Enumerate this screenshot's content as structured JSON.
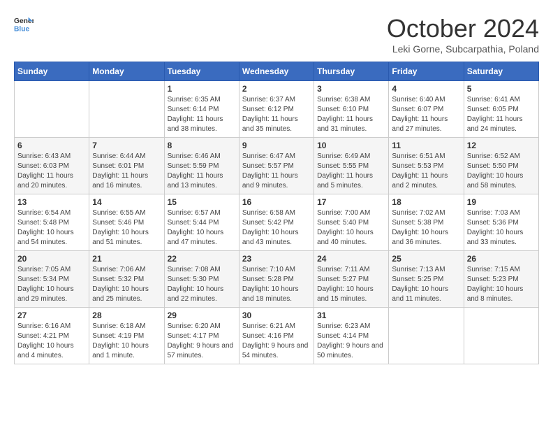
{
  "header": {
    "logo_line1": "General",
    "logo_line2": "Blue",
    "month_title": "October 2024",
    "subtitle": "Leki Gorne, Subcarpathia, Poland"
  },
  "days_of_week": [
    "Sunday",
    "Monday",
    "Tuesday",
    "Wednesday",
    "Thursday",
    "Friday",
    "Saturday"
  ],
  "weeks": [
    [
      {
        "day": "",
        "detail": ""
      },
      {
        "day": "",
        "detail": ""
      },
      {
        "day": "1",
        "detail": "Sunrise: 6:35 AM\nSunset: 6:14 PM\nDaylight: 11 hours and 38 minutes."
      },
      {
        "day": "2",
        "detail": "Sunrise: 6:37 AM\nSunset: 6:12 PM\nDaylight: 11 hours and 35 minutes."
      },
      {
        "day": "3",
        "detail": "Sunrise: 6:38 AM\nSunset: 6:10 PM\nDaylight: 11 hours and 31 minutes."
      },
      {
        "day": "4",
        "detail": "Sunrise: 6:40 AM\nSunset: 6:07 PM\nDaylight: 11 hours and 27 minutes."
      },
      {
        "day": "5",
        "detail": "Sunrise: 6:41 AM\nSunset: 6:05 PM\nDaylight: 11 hours and 24 minutes."
      }
    ],
    [
      {
        "day": "6",
        "detail": "Sunrise: 6:43 AM\nSunset: 6:03 PM\nDaylight: 11 hours and 20 minutes."
      },
      {
        "day": "7",
        "detail": "Sunrise: 6:44 AM\nSunset: 6:01 PM\nDaylight: 11 hours and 16 minutes."
      },
      {
        "day": "8",
        "detail": "Sunrise: 6:46 AM\nSunset: 5:59 PM\nDaylight: 11 hours and 13 minutes."
      },
      {
        "day": "9",
        "detail": "Sunrise: 6:47 AM\nSunset: 5:57 PM\nDaylight: 11 hours and 9 minutes."
      },
      {
        "day": "10",
        "detail": "Sunrise: 6:49 AM\nSunset: 5:55 PM\nDaylight: 11 hours and 5 minutes."
      },
      {
        "day": "11",
        "detail": "Sunrise: 6:51 AM\nSunset: 5:53 PM\nDaylight: 11 hours and 2 minutes."
      },
      {
        "day": "12",
        "detail": "Sunrise: 6:52 AM\nSunset: 5:50 PM\nDaylight: 10 hours and 58 minutes."
      }
    ],
    [
      {
        "day": "13",
        "detail": "Sunrise: 6:54 AM\nSunset: 5:48 PM\nDaylight: 10 hours and 54 minutes."
      },
      {
        "day": "14",
        "detail": "Sunrise: 6:55 AM\nSunset: 5:46 PM\nDaylight: 10 hours and 51 minutes."
      },
      {
        "day": "15",
        "detail": "Sunrise: 6:57 AM\nSunset: 5:44 PM\nDaylight: 10 hours and 47 minutes."
      },
      {
        "day": "16",
        "detail": "Sunrise: 6:58 AM\nSunset: 5:42 PM\nDaylight: 10 hours and 43 minutes."
      },
      {
        "day": "17",
        "detail": "Sunrise: 7:00 AM\nSunset: 5:40 PM\nDaylight: 10 hours and 40 minutes."
      },
      {
        "day": "18",
        "detail": "Sunrise: 7:02 AM\nSunset: 5:38 PM\nDaylight: 10 hours and 36 minutes."
      },
      {
        "day": "19",
        "detail": "Sunrise: 7:03 AM\nSunset: 5:36 PM\nDaylight: 10 hours and 33 minutes."
      }
    ],
    [
      {
        "day": "20",
        "detail": "Sunrise: 7:05 AM\nSunset: 5:34 PM\nDaylight: 10 hours and 29 minutes."
      },
      {
        "day": "21",
        "detail": "Sunrise: 7:06 AM\nSunset: 5:32 PM\nDaylight: 10 hours and 25 minutes."
      },
      {
        "day": "22",
        "detail": "Sunrise: 7:08 AM\nSunset: 5:30 PM\nDaylight: 10 hours and 22 minutes."
      },
      {
        "day": "23",
        "detail": "Sunrise: 7:10 AM\nSunset: 5:28 PM\nDaylight: 10 hours and 18 minutes."
      },
      {
        "day": "24",
        "detail": "Sunrise: 7:11 AM\nSunset: 5:27 PM\nDaylight: 10 hours and 15 minutes."
      },
      {
        "day": "25",
        "detail": "Sunrise: 7:13 AM\nSunset: 5:25 PM\nDaylight: 10 hours and 11 minutes."
      },
      {
        "day": "26",
        "detail": "Sunrise: 7:15 AM\nSunset: 5:23 PM\nDaylight: 10 hours and 8 minutes."
      }
    ],
    [
      {
        "day": "27",
        "detail": "Sunrise: 6:16 AM\nSunset: 4:21 PM\nDaylight: 10 hours and 4 minutes."
      },
      {
        "day": "28",
        "detail": "Sunrise: 6:18 AM\nSunset: 4:19 PM\nDaylight: 10 hours and 1 minute."
      },
      {
        "day": "29",
        "detail": "Sunrise: 6:20 AM\nSunset: 4:17 PM\nDaylight: 9 hours and 57 minutes."
      },
      {
        "day": "30",
        "detail": "Sunrise: 6:21 AM\nSunset: 4:16 PM\nDaylight: 9 hours and 54 minutes."
      },
      {
        "day": "31",
        "detail": "Sunrise: 6:23 AM\nSunset: 4:14 PM\nDaylight: 9 hours and 50 minutes."
      },
      {
        "day": "",
        "detail": ""
      },
      {
        "day": "",
        "detail": ""
      }
    ]
  ]
}
